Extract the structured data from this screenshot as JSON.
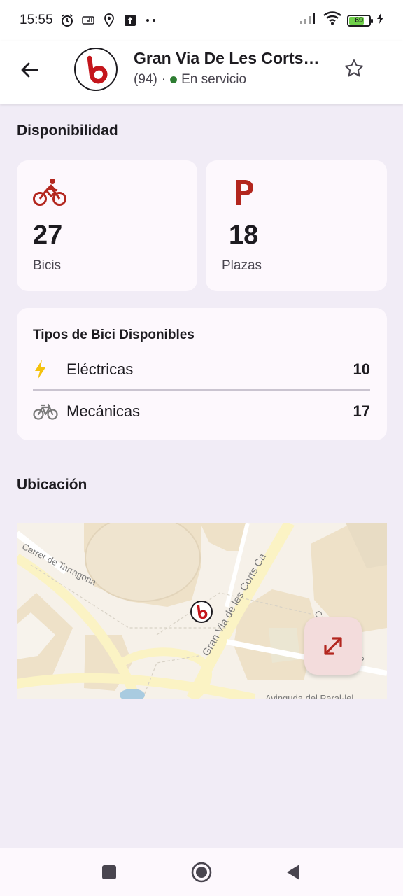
{
  "status_bar": {
    "time": "15:55",
    "left_icons": [
      "alarm-icon",
      "keyboard-icon",
      "location-icon",
      "upload-icon",
      "more-dots-icon"
    ],
    "right_icons": [
      "signal-icon",
      "wifi-icon",
      "battery-icon",
      "charging-icon"
    ],
    "battery_level": "69",
    "battery_fraction": 0.69
  },
  "header": {
    "back_icon": "arrow-back-icon",
    "logo_icon": "bicing-logo-icon",
    "title": "Gran  Via De Les Corts Catalanes",
    "count": "(94)",
    "separator": "·",
    "status_text": "En servicio",
    "status_color": "#2e7d32",
    "favorite_icon": "star-outline-icon"
  },
  "availability": {
    "section_title": "Disponibilidad",
    "bikes": {
      "icon": "bike-rider-icon",
      "value": "27",
      "label": "Bicis"
    },
    "docks": {
      "icon": "parking-p-icon",
      "value": "18",
      "label": "Plazas"
    }
  },
  "bike_types": {
    "title": "Tipos de Bici Disponibles",
    "rows": [
      {
        "icon": "lightning-icon",
        "name": "Eléctricas",
        "value": "10"
      },
      {
        "icon": "bicycle-icon",
        "name": "Mecánicas",
        "value": "17"
      }
    ]
  },
  "location": {
    "section_title": "Ubicación",
    "map_labels": {
      "street_1": "Carrer de Tarragona",
      "street_2": "Gran Via de les Corts Ca",
      "street_3": "Avinguda del Paral·lel",
      "street_4": "Ca",
      "street_5": "nça"
    },
    "marker_icon": "bicing-marker-icon",
    "expand_icon": "expand-arrows-icon"
  },
  "nav_bar": {
    "buttons": [
      "recent-apps-icon",
      "home-icon",
      "back-triangle-icon"
    ]
  },
  "colors": {
    "brand_red": "#c4161c",
    "icon_red": "#b3261e",
    "lightning_yellow": "#f4c20d",
    "background": "#f1ecf6",
    "card": "#fdf8fd"
  }
}
